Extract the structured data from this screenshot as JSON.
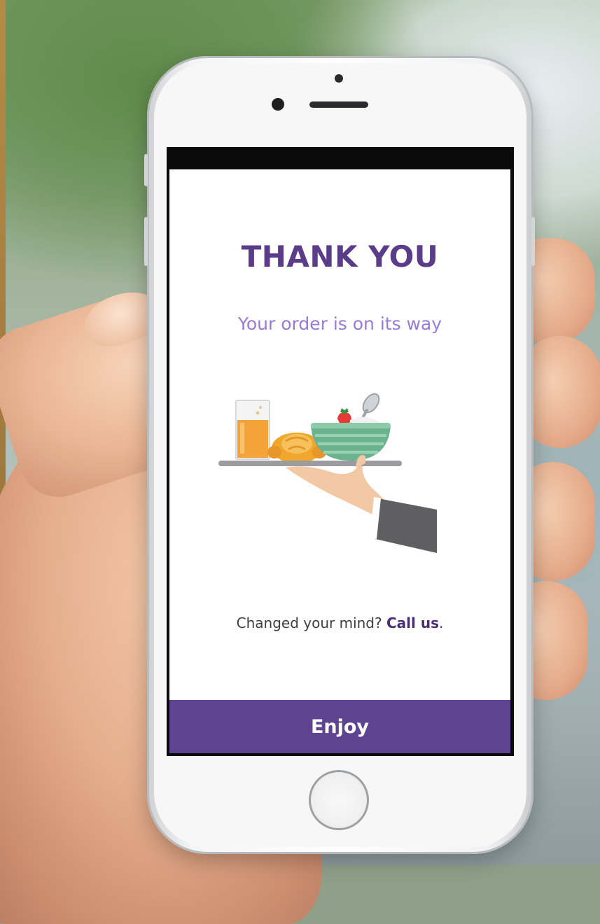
{
  "screen": {
    "title": "THANK YOU",
    "subtitle": "Your order is on its way",
    "change_prompt": "Changed your mind?",
    "call_link": "Call us",
    "call_suffix": ".",
    "primary_button": "Enjoy"
  },
  "illustration": {
    "icon": "food-tray-served-icon",
    "items": [
      "juice-glass-icon",
      "croissant-icon",
      "salad-bowl-icon",
      "strawberry-icon",
      "spoon-icon",
      "waiter-hand-icon"
    ]
  },
  "colors": {
    "title": "#5b3c88",
    "subtitle": "#9a7bd4",
    "button_bg": "#5e4490",
    "button_text": "#ffffff",
    "link": "#4a2d74"
  }
}
